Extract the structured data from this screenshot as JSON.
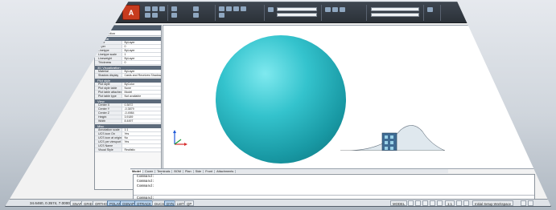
{
  "app": {
    "menu_letter": "A",
    "colors": {
      "sphere": "#2fbcc6",
      "ribbon_dark": "#2f363e",
      "panel_header": "#5d6b7b"
    }
  },
  "properties": {
    "title": "Properties",
    "selection": "No selection",
    "sections": [
      {
        "name": "General",
        "rows": [
          [
            "Color",
            "ByLayer"
          ],
          [
            "Layer",
            "0"
          ],
          [
            "Linetype",
            "ByLayer"
          ],
          [
            "Linetype scale",
            "1"
          ],
          [
            "Lineweight",
            "ByLayer"
          ],
          [
            "Thickness",
            "0"
          ]
        ]
      },
      {
        "name": "3D Visualization",
        "rows": [
          [
            "Material",
            "ByLayer"
          ],
          [
            "Shadow display",
            "Casts and Receives Shadows"
          ]
        ]
      },
      {
        "name": "Plot style",
        "rows": [
          [
            "Plot style",
            "ByColor"
          ],
          [
            "Plot style table",
            "None"
          ],
          [
            "Plot table attached to",
            "Model"
          ],
          [
            "Plot table type",
            "Not available"
          ]
        ]
      },
      {
        "name": "View",
        "rows": [
          [
            "Center X",
            "0.3872"
          ],
          [
            "Center Y",
            "-0.3879"
          ],
          [
            "Center Z",
            "-0.4984"
          ],
          [
            "Height",
            "3.9189"
          ],
          [
            "Width",
            "8.4497"
          ]
        ]
      },
      {
        "name": "Misc",
        "rows": [
          [
            "Annotation scale",
            "1:1"
          ],
          [
            "UCS icon On",
            "Yes"
          ],
          [
            "UCS icon at origin",
            "No"
          ],
          [
            "UCS per viewport",
            "Yes"
          ],
          [
            "UCS Name",
            ""
          ],
          [
            "Visual Style",
            "Realistic"
          ]
        ]
      }
    ]
  },
  "tabs": [
    "Model",
    "Cover",
    "Terminals",
    "BOM",
    "Plan",
    "Side",
    "Front",
    "Attachments"
  ],
  "command": {
    "history": [
      "Command:",
      "Command:",
      "Command:"
    ],
    "prompt": "Command:"
  },
  "status": {
    "coords": "34.6460, 0.3574, 7.0000",
    "toggles": [
      {
        "label": "SNAP",
        "on": false
      },
      {
        "label": "GRID",
        "on": false
      },
      {
        "label": "ORTHO",
        "on": false
      },
      {
        "label": "POLAR",
        "on": true
      },
      {
        "label": "OSNAP",
        "on": true
      },
      {
        "label": "OTRACK",
        "on": true
      },
      {
        "label": "DUCS",
        "on": false
      },
      {
        "label": "DYN",
        "on": true
      },
      {
        "label": "LWT",
        "on": false
      },
      {
        "label": "QP",
        "on": false
      }
    ],
    "model_label": "MODEL",
    "scale": "1:1",
    "workspace": "Initial Setup Workspace"
  }
}
